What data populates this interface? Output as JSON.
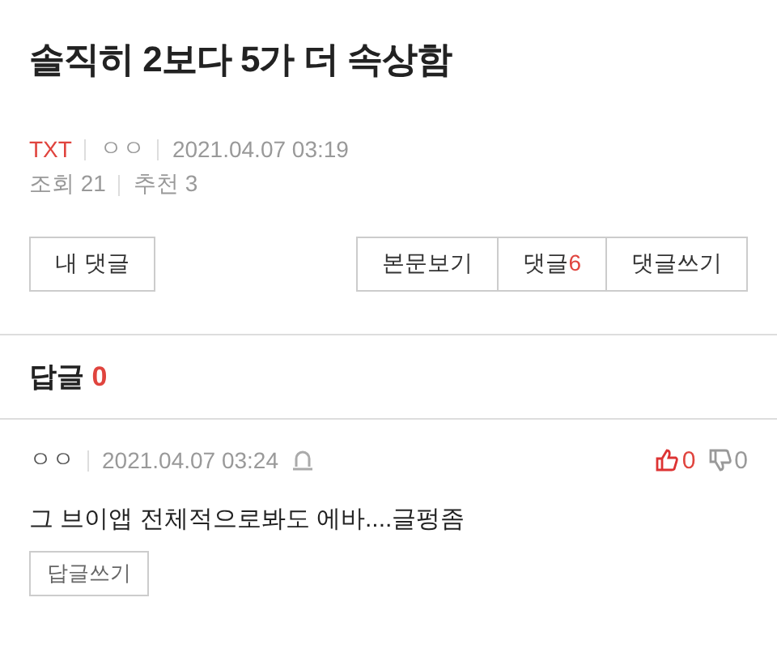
{
  "post": {
    "title": "솔직히 2보다 5가 더 속상함",
    "category": "TXT",
    "author": "ㅇㅇ",
    "datetime": "2021.04.07 03:19",
    "views": "조회 21",
    "recommends": "추천 3"
  },
  "actions": {
    "left": [
      {
        "label": "내 댓글"
      }
    ],
    "right": [
      {
        "label": "본문보기"
      },
      {
        "label": "댓글",
        "count": "6"
      },
      {
        "label": "댓글쓰기"
      }
    ]
  },
  "replies": {
    "heading": "답글",
    "count": "0"
  },
  "comments": [
    {
      "author": "ㅇㅇ",
      "datetime": "2021.04.07 03:24",
      "likes": "0",
      "dislikes": "0",
      "text": "그 브이앱 전체적으로봐도 에바....글펑좀",
      "reply_button": "답글쓰기"
    }
  ]
}
